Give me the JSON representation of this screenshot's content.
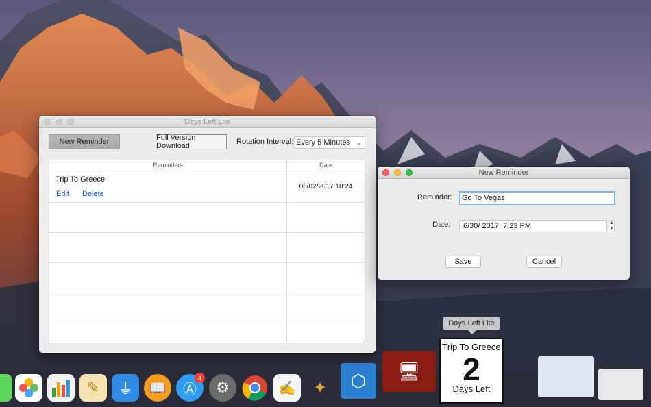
{
  "main_window": {
    "title": "Days Left Lite",
    "new_reminder_label": "New Reminder",
    "full_version_label": "Full Version Download",
    "rotation_label": "Rotation Interval:",
    "rotation_value": "Every 5 Minutes",
    "table": {
      "headers": [
        "Reminders",
        "Date"
      ],
      "rows": [
        {
          "title": "Trip To Greece",
          "date": "06/02/2017 18:24",
          "edit": "Edit",
          "delete": "Delete"
        }
      ]
    }
  },
  "reminder_window": {
    "title": "New Reminder",
    "reminder_label": "Reminder:",
    "reminder_value": "Go To Vegas",
    "date_label": "Date:",
    "date_value": "6/30/ 2017,   7:23 PM",
    "save_label": "Save",
    "cancel_label": "Cancel"
  },
  "dock": {
    "tooltip": "Days Left Lite",
    "app_store_badge": "4",
    "tile": {
      "trip": "Trip To Greece",
      "days": "2",
      "label": "Days Left"
    },
    "icons": [
      "photos-icon",
      "numbers-icon",
      "pages-icon",
      "keynote-icon",
      "ibooks-icon",
      "app-store-icon",
      "system-preferences-icon",
      "chrome-icon",
      "textedit-icon",
      "game-icon",
      "scanner-icon",
      "theater-icon",
      "days-left-icon",
      "window-thumbnail-icon"
    ]
  },
  "colors": {
    "accent_link": "#1a4fd6",
    "focus_ring": "#7fb0ef",
    "close": "#fc5f57",
    "minimize": "#fdbc2e",
    "zoom": "#2bc840",
    "badge": "#ff3b30"
  }
}
